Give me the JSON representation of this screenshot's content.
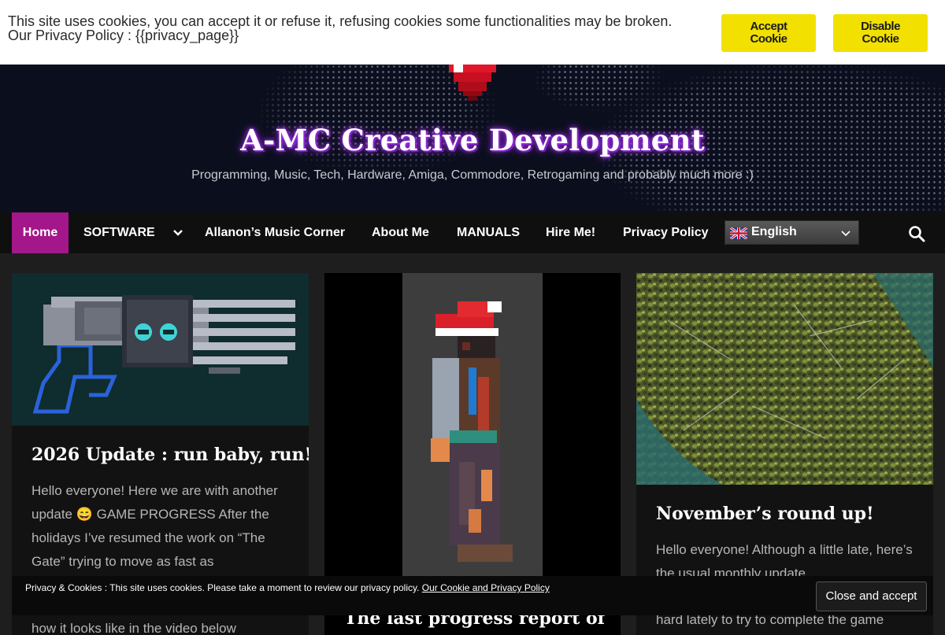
{
  "cookie_bar": {
    "text_line1": "This site uses cookies, you can accept it or refuse it, refusing cookies some functionalities may be broken.",
    "text_line2": "Our Privacy Policy : {{privacy_page}}",
    "accept_line1": "Accept",
    "accept_line2": "Cookie",
    "disable_line1": "Disable",
    "disable_line2": "Cookie",
    "button_color": "#f1e000"
  },
  "header": {
    "title": "A-MC Creative Development",
    "tagline": "Programming, Music, Tech, Hardware, Amiga, Commodore, Retrogaming and probably much more :)",
    "logo_icon": "pixel-heart-icon"
  },
  "nav": {
    "items": [
      {
        "label": "Home",
        "active": true
      },
      {
        "label": "SOFTWARE"
      },
      {
        "label": "Allanon’s Music Corner"
      },
      {
        "label": "About Me"
      },
      {
        "label": "MANUALS"
      },
      {
        "label": "Hire Me!"
      },
      {
        "label": "Privacy Policy"
      }
    ],
    "active_color": "#a3178a",
    "language": {
      "label": "English",
      "flag": "uk-flag-icon"
    },
    "search_icon": "search-icon"
  },
  "posts": [
    {
      "title": "2026 Update : run baby, run!",
      "excerpt": "Hello everyone! Here we are with another update 😄 GAME PROGRESS After the holidays I’ve resumed the work on “The Gate” trying to move as fast as",
      "excerpt_tail": "how it looks like in the video below"
    },
    {
      "title": "The last progress report of"
    },
    {
      "title": "November’s round up!",
      "excerpt": "Hello everyone! Although a little late, here’s the usual monthly update.",
      "excerpt_tail": "hard lately to try to complete the game"
    }
  ],
  "privacy_bar": {
    "text": "Privacy & Cookies : This site uses cookies. Please take a moment to review our privacy policy. ",
    "link": "Our Cookie and Privacy Policy",
    "close_label": "Close and accept"
  }
}
